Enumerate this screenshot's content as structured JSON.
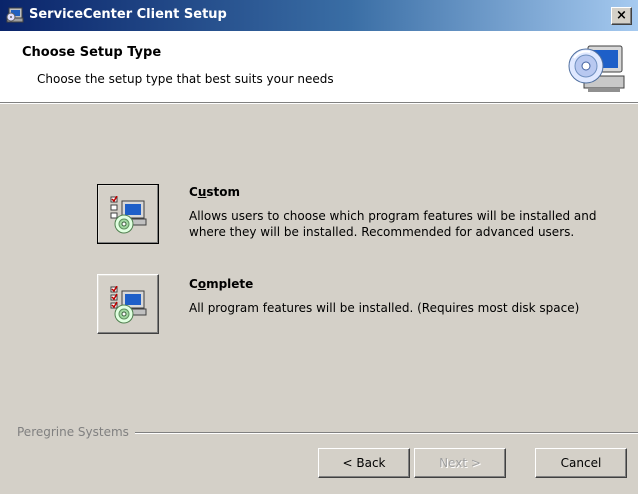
{
  "window": {
    "title": "ServiceCenter Client Setup",
    "close_label": "×"
  },
  "header": {
    "title": "Choose Setup Type",
    "subtitle": "Choose the setup type that best suits your needs"
  },
  "options": [
    {
      "title_pre": "C",
      "title_accel": "u",
      "title_post": "stom",
      "description": "Allows users to choose which program features will be installed and where they will be installed. Recommended for advanced users."
    },
    {
      "title_pre": "C",
      "title_accel": "o",
      "title_post": "mplete",
      "description": "All program features will be installed.  (Requires most disk space)"
    }
  ],
  "footer": {
    "brand": "Peregrine Systems",
    "back_label": "< Back",
    "next_label": "Next >",
    "cancel_label": "Cancel"
  }
}
